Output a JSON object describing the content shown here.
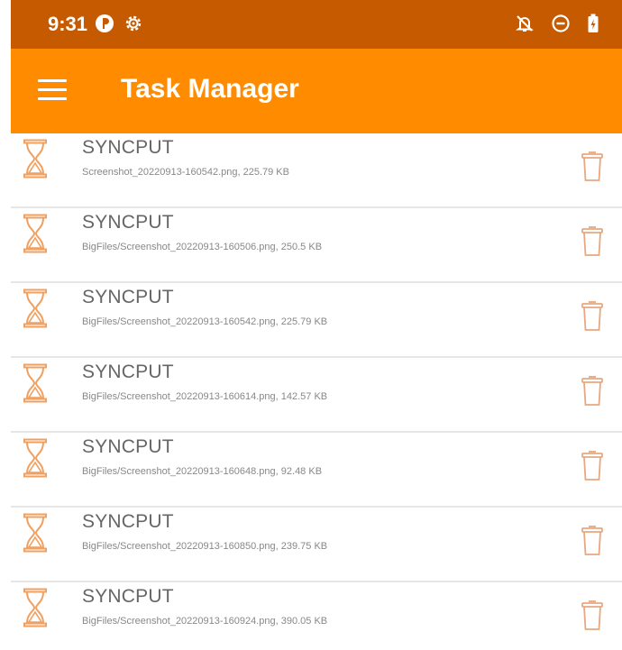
{
  "status_bar": {
    "time": "9:31",
    "left_icons": [
      "app-p-icon",
      "settings-gear-icon"
    ],
    "right_icons": [
      "notifications-off-icon",
      "do-not-disturb-icon",
      "battery-icon"
    ]
  },
  "app_bar": {
    "title": "Task Manager",
    "menu_icon": "hamburger-menu-icon"
  },
  "colors": {
    "status_bar": "#C65A00",
    "app_bar": "#FF8C00",
    "icon_accent": "#F0A060",
    "title_text": "#666666",
    "detail_text": "#888888"
  },
  "tasks": [
    {
      "name": "SYNCPUT",
      "detail": "Screenshot_20220913-160542.png, 225.79 KB",
      "icon": "hourglass-icon",
      "action_icon": "trash-icon"
    },
    {
      "name": "SYNCPUT",
      "detail": "BigFiles/Screenshot_20220913-160506.png, 250.5 KB",
      "icon": "hourglass-icon",
      "action_icon": "trash-icon"
    },
    {
      "name": "SYNCPUT",
      "detail": "BigFiles/Screenshot_20220913-160542.png, 225.79 KB",
      "icon": "hourglass-icon",
      "action_icon": "trash-icon"
    },
    {
      "name": "SYNCPUT",
      "detail": "BigFiles/Screenshot_20220913-160614.png, 142.57 KB",
      "icon": "hourglass-icon",
      "action_icon": "trash-icon"
    },
    {
      "name": "SYNCPUT",
      "detail": "BigFiles/Screenshot_20220913-160648.png, 92.48 KB",
      "icon": "hourglass-icon",
      "action_icon": "trash-icon"
    },
    {
      "name": "SYNCPUT",
      "detail": "BigFiles/Screenshot_20220913-160850.png, 239.75 KB",
      "icon": "hourglass-icon",
      "action_icon": "trash-icon"
    },
    {
      "name": "SYNCPUT",
      "detail": "BigFiles/Screenshot_20220913-160924.png, 390.05 KB",
      "icon": "hourglass-icon",
      "action_icon": "trash-icon"
    }
  ]
}
